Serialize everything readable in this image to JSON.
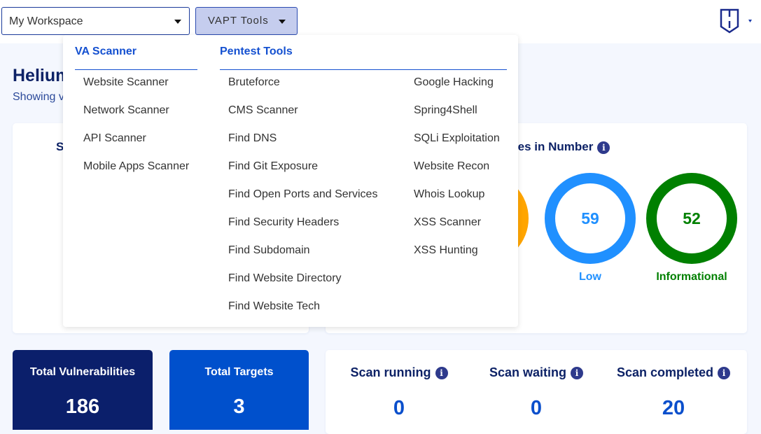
{
  "topbar": {
    "workspace": "My Workspace",
    "vapt_label": "VAPT Tools"
  },
  "page": {
    "title": "Helium",
    "subtitle": "Showing v"
  },
  "left_card": {
    "title": "S"
  },
  "right_card": {
    "title": "Vulnerabilities in Number",
    "rings": [
      {
        "label": "",
        "value": "",
        "color": "#ffa500"
      },
      {
        "label": "Low",
        "value": "59",
        "color": "#2090ff"
      },
      {
        "label": "Informational",
        "value": "52",
        "color": "#008000"
      }
    ]
  },
  "stats": [
    {
      "label": "Total Vulnerabilities",
      "value": "186",
      "color": "#0b1f6b"
    },
    {
      "label": "Total Targets",
      "value": "3",
      "color": "#0050cc"
    }
  ],
  "scans": [
    {
      "label": "Scan running",
      "value": "0"
    },
    {
      "label": "Scan waiting",
      "value": "0"
    },
    {
      "label": "Scan completed",
      "value": "20"
    }
  ],
  "dropdown": {
    "va_heading": "VA Scanner",
    "va_items": [
      "Website Scanner",
      "Network Scanner",
      "API Scanner",
      "Mobile Apps Scanner"
    ],
    "pentest_heading": "Pentest Tools",
    "pentest_col1": [
      "Bruteforce",
      "CMS Scanner",
      "Find DNS",
      "Find Git Exposure",
      "Find Open Ports and Services",
      "Find Security Headers",
      "Find Subdomain",
      "Find Website Directory",
      "Find Website Tech"
    ],
    "pentest_col2": [
      "Google Hacking",
      "Spring4Shell",
      "SQLi Exploitation",
      "Website Recon",
      "Whois Lookup",
      "XSS Scanner",
      "XSS Hunting"
    ]
  }
}
